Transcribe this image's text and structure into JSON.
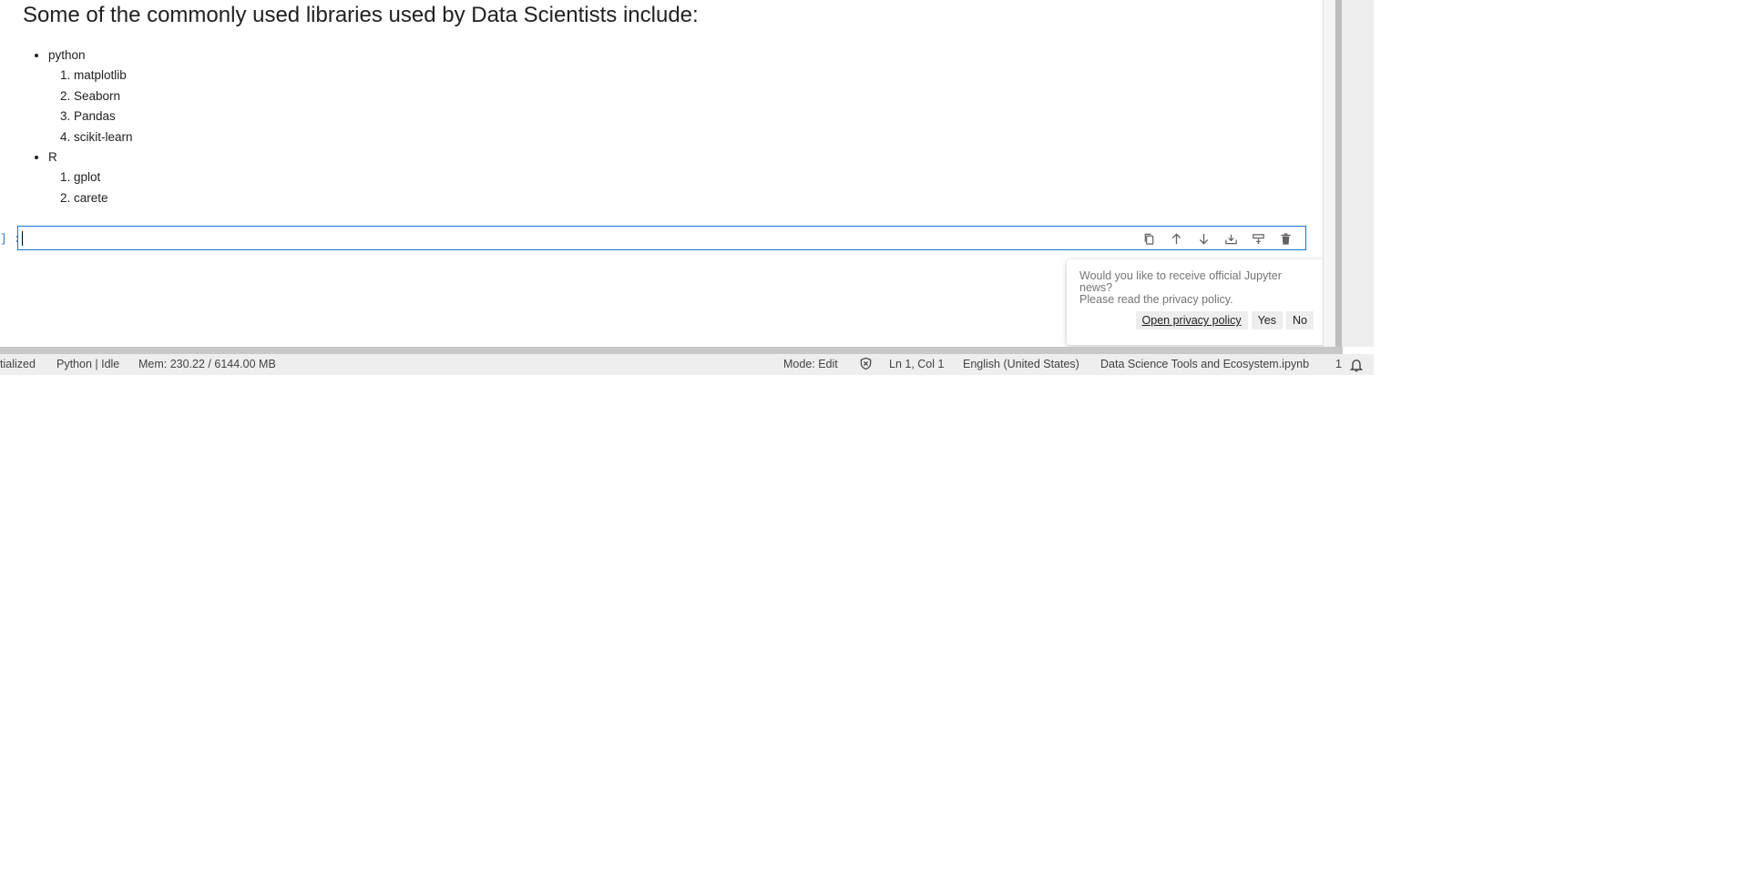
{
  "markdown": {
    "heading": "Some of the commonly used libraries used by Data Scientists include:",
    "groups": [
      {
        "label": "python",
        "items": [
          "matplotlib",
          "Seaborn",
          "Pandas",
          "scikit-learn"
        ]
      },
      {
        "label": "R",
        "items": [
          "gplot",
          "carete"
        ]
      }
    ]
  },
  "code_cell": {
    "prompt": "] :",
    "value": ""
  },
  "cell_toolbar": {
    "icons": [
      "duplicate-icon",
      "move-up-icon",
      "move-down-icon",
      "insert-below-icon",
      "insert-above-icon",
      "delete-icon"
    ]
  },
  "status_bar": {
    "kernel_init": "tialized",
    "kernel_status": "Python | Idle",
    "memory": "Mem: 230.22 / 6144.00 MB",
    "mode": "Mode: Edit",
    "position": "Ln 1, Col 1",
    "language": "English (United States)",
    "filename": "Data Science Tools and Ecosystem.ipynb",
    "notification_count": "1"
  },
  "news_popup": {
    "line1": "Would you like to receive official Jupyter news?",
    "line2": "Please read the privacy policy.",
    "privacy_label": "Open privacy policy",
    "yes_label": "Yes",
    "no_label": "No"
  },
  "colors": {
    "accent": "#1976d2",
    "prompt": "#307fc1"
  }
}
